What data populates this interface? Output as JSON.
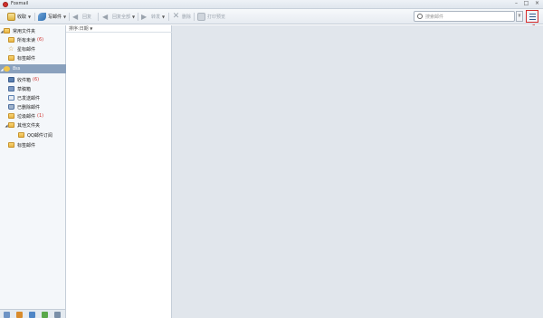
{
  "window": {
    "title": "Foxmail"
  },
  "toolbar": {
    "receive": "收取",
    "compose": "写邮件",
    "reply": "回复",
    "reply_all": "回复全部",
    "forward": "转发",
    "delete": "删除",
    "print": "打印预览"
  },
  "search": {
    "placeholder": "搜索邮件"
  },
  "sidebar": {
    "common_header": "常用文件夹",
    "common": [
      {
        "label": "所有未读",
        "count": "(6)"
      },
      {
        "label": "星标邮件",
        "count": ""
      },
      {
        "label": "标签邮件",
        "count": ""
      }
    ],
    "account": "8ss",
    "account_items": [
      {
        "label": "收件箱",
        "count": "(6)"
      },
      {
        "label": "草稿箱",
        "count": ""
      },
      {
        "label": "已发送邮件",
        "count": ""
      },
      {
        "label": "已删除邮件",
        "count": ""
      },
      {
        "label": "垃圾邮件",
        "count": "(1)"
      },
      {
        "label": "其他文件夹",
        "count": ""
      },
      {
        "label": "QQ邮件订阅",
        "count": ""
      },
      {
        "label": "标签邮件",
        "count": ""
      }
    ]
  },
  "list": {
    "sort_label": "排序:日期"
  },
  "colors": {
    "accent": "#3a5c8c",
    "selected": "#8aa1bd",
    "highlight": "#d42a2a",
    "count": "#d0312d"
  }
}
